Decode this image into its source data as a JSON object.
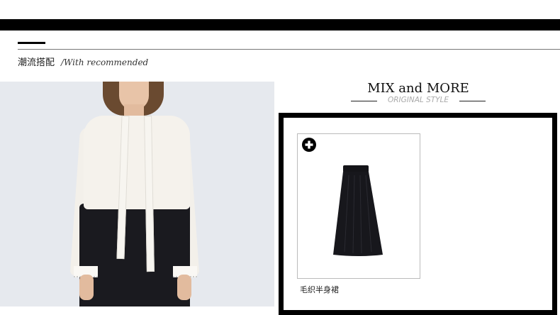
{
  "header": {
    "section_title_cn": "潮流搭配",
    "section_title_en": "/With recommended"
  },
  "photo": {
    "icon": "model-photo"
  },
  "mix": {
    "title": "MIX and MORE",
    "subtitle": "ORIGINAL STYLE"
  },
  "products": [
    {
      "name": "毛织半身裙",
      "icon": "plus-circle-icon",
      "image": "black-midi-skirt"
    }
  ],
  "colors": {
    "accent": "#000000",
    "subtitle": "#aaaaaa",
    "skirt": "#1a1a1f",
    "blouse": "#f5f2ec"
  }
}
